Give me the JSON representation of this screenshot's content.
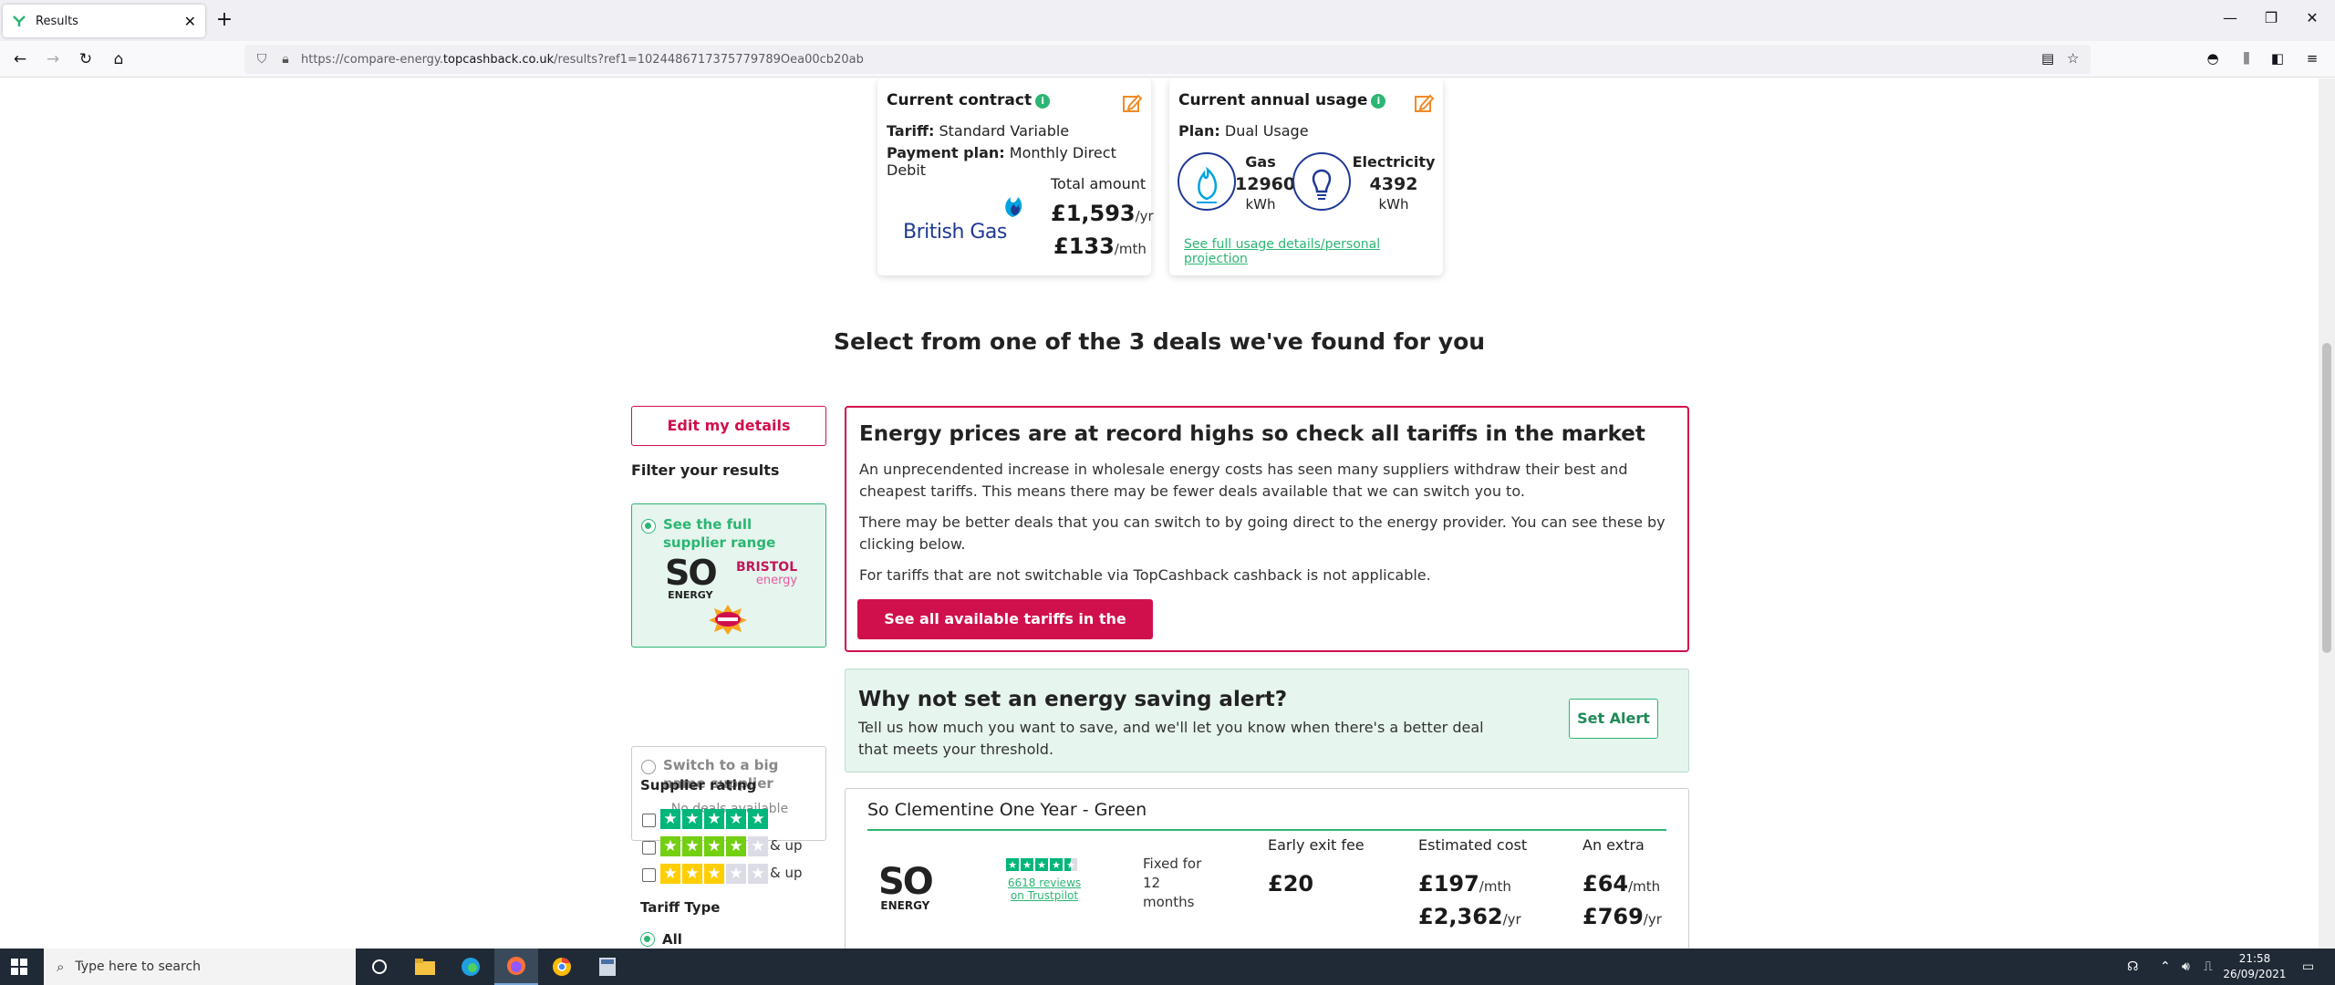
{
  "browser": {
    "tab_title": "Results",
    "new_tab": "+",
    "url_prefix": "https://compare-energy.",
    "url_domain": "topcashback.co.uk",
    "url_suffix": "/results?ref1=1024486717375779789Oea00cb20ab"
  },
  "contract": {
    "title": "Current contract",
    "tariff_label": "Tariff:",
    "tariff_value": "Standard Variable",
    "payment_label": "Payment plan:",
    "payment_value": "Monthly Direct Debit",
    "supplier_logo_text": "British Gas",
    "total_label": "Total amount",
    "yearly": "£1,593",
    "yearly_unit": "/yr",
    "monthly": "£133",
    "monthly_unit": "/mth"
  },
  "usage": {
    "title": "Current annual usage",
    "plan_label": "Plan:",
    "plan_value": "Dual Usage",
    "gas_label": "Gas",
    "gas_value": "12960",
    "gas_unit": "kWh",
    "elec_label": "Electricity",
    "elec_value": "4392",
    "elec_unit": "kWh",
    "details_link": "See full usage details/personal projection"
  },
  "main_heading": "Select from one of the 3 deals we've found for you",
  "sidebar": {
    "edit_button": "Edit my details",
    "filter_title": "Filter your results",
    "option_full": "See the full supplier range",
    "logo_so_1": "SO",
    "logo_so_2": "ENERGY",
    "logo_bristol_1": "BRISTOL",
    "logo_bristol_2": "energy",
    "option_big": "Switch to a big name supplier",
    "no_deals": "No deals available",
    "rating_title": "Supplier rating",
    "and_up": "& up",
    "tariff_type_title": "Tariff Type",
    "tariff_all": "All"
  },
  "alert": {
    "heading": "Energy prices are at record highs so check all tariffs in the market",
    "para1": "An unprecendented increase in wholesale energy costs has seen many suppliers withdraw their best and cheapest tariffs. This means there may be fewer deals available that we can switch you to.",
    "para2": "There may be better deals that you can switch to by going direct to the energy provider. You can see these by clicking below.",
    "para3": "For tariffs that are not switchable via TopCashback cashback is not applicable.",
    "button": "See all available tariffs in the market"
  },
  "saving": {
    "heading": "Why not set an energy saving alert?",
    "text": "Tell us how much you want to save, and we'll let you know when there's a better deal that meets your threshold.",
    "button": "Set Alert"
  },
  "deal": {
    "title": "So Clementine One Year - Green",
    "logo_1": "SO",
    "logo_2": "ENERGY",
    "reviews": "6618 reviews",
    "reviews_on": "on Trustpilot",
    "fixed": "Fixed for 12 months",
    "exit_label": "Early exit fee",
    "exit_value": "£20",
    "est_label": "Estimated cost",
    "est_monthly": "£197",
    "est_monthly_unit": "/mth",
    "est_yearly": "£2,362",
    "est_yearly_unit": "/yr",
    "extra_label": "An extra",
    "extra_monthly": "£64",
    "extra_monthly_unit": "/mth",
    "extra_yearly": "£769",
    "extra_yearly_unit": "/yr"
  },
  "taskbar": {
    "search_placeholder": "Type here to search",
    "time": "21:58",
    "date": "26/09/2021"
  },
  "colors": {
    "brand_red": "#d0104c",
    "brand_green": "#2bb673",
    "trustpilot_green": "#00b67a"
  }
}
